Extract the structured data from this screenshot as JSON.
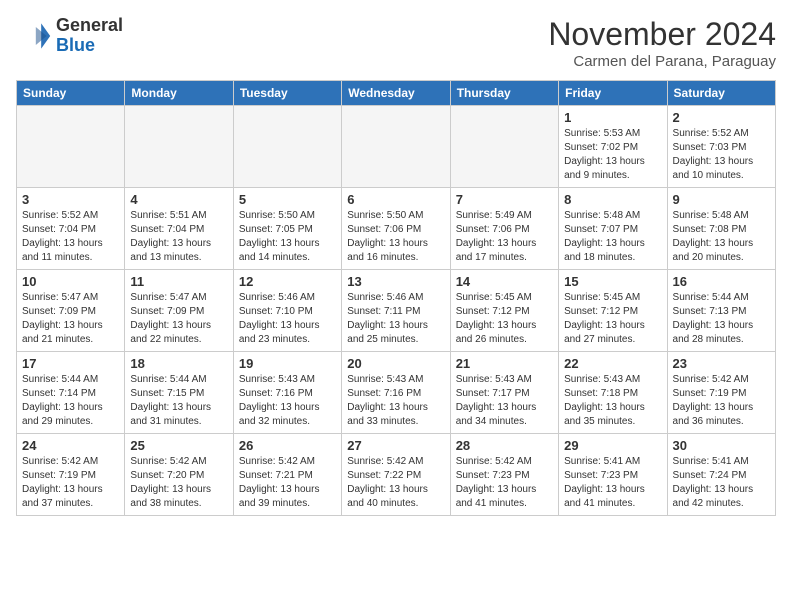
{
  "header": {
    "logo_line1": "General",
    "logo_line2": "Blue",
    "month": "November 2024",
    "location": "Carmen del Parana, Paraguay"
  },
  "weekdays": [
    "Sunday",
    "Monday",
    "Tuesday",
    "Wednesday",
    "Thursday",
    "Friday",
    "Saturday"
  ],
  "weeks": [
    [
      {
        "day": null
      },
      {
        "day": null
      },
      {
        "day": null
      },
      {
        "day": null
      },
      {
        "day": null
      },
      {
        "day": "1",
        "sunrise": "5:53 AM",
        "sunset": "7:02 PM",
        "daylight": "13 hours and 9 minutes."
      },
      {
        "day": "2",
        "sunrise": "5:52 AM",
        "sunset": "7:03 PM",
        "daylight": "13 hours and 10 minutes."
      }
    ],
    [
      {
        "day": "3",
        "sunrise": "5:52 AM",
        "sunset": "7:04 PM",
        "daylight": "13 hours and 11 minutes."
      },
      {
        "day": "4",
        "sunrise": "5:51 AM",
        "sunset": "7:04 PM",
        "daylight": "13 hours and 13 minutes."
      },
      {
        "day": "5",
        "sunrise": "5:50 AM",
        "sunset": "7:05 PM",
        "daylight": "13 hours and 14 minutes."
      },
      {
        "day": "6",
        "sunrise": "5:50 AM",
        "sunset": "7:06 PM",
        "daylight": "13 hours and 16 minutes."
      },
      {
        "day": "7",
        "sunrise": "5:49 AM",
        "sunset": "7:06 PM",
        "daylight": "13 hours and 17 minutes."
      },
      {
        "day": "8",
        "sunrise": "5:48 AM",
        "sunset": "7:07 PM",
        "daylight": "13 hours and 18 minutes."
      },
      {
        "day": "9",
        "sunrise": "5:48 AM",
        "sunset": "7:08 PM",
        "daylight": "13 hours and 20 minutes."
      }
    ],
    [
      {
        "day": "10",
        "sunrise": "5:47 AM",
        "sunset": "7:09 PM",
        "daylight": "13 hours and 21 minutes."
      },
      {
        "day": "11",
        "sunrise": "5:47 AM",
        "sunset": "7:09 PM",
        "daylight": "13 hours and 22 minutes."
      },
      {
        "day": "12",
        "sunrise": "5:46 AM",
        "sunset": "7:10 PM",
        "daylight": "13 hours and 23 minutes."
      },
      {
        "day": "13",
        "sunrise": "5:46 AM",
        "sunset": "7:11 PM",
        "daylight": "13 hours and 25 minutes."
      },
      {
        "day": "14",
        "sunrise": "5:45 AM",
        "sunset": "7:12 PM",
        "daylight": "13 hours and 26 minutes."
      },
      {
        "day": "15",
        "sunrise": "5:45 AM",
        "sunset": "7:12 PM",
        "daylight": "13 hours and 27 minutes."
      },
      {
        "day": "16",
        "sunrise": "5:44 AM",
        "sunset": "7:13 PM",
        "daylight": "13 hours and 28 minutes."
      }
    ],
    [
      {
        "day": "17",
        "sunrise": "5:44 AM",
        "sunset": "7:14 PM",
        "daylight": "13 hours and 29 minutes."
      },
      {
        "day": "18",
        "sunrise": "5:44 AM",
        "sunset": "7:15 PM",
        "daylight": "13 hours and 31 minutes."
      },
      {
        "day": "19",
        "sunrise": "5:43 AM",
        "sunset": "7:16 PM",
        "daylight": "13 hours and 32 minutes."
      },
      {
        "day": "20",
        "sunrise": "5:43 AM",
        "sunset": "7:16 PM",
        "daylight": "13 hours and 33 minutes."
      },
      {
        "day": "21",
        "sunrise": "5:43 AM",
        "sunset": "7:17 PM",
        "daylight": "13 hours and 34 minutes."
      },
      {
        "day": "22",
        "sunrise": "5:43 AM",
        "sunset": "7:18 PM",
        "daylight": "13 hours and 35 minutes."
      },
      {
        "day": "23",
        "sunrise": "5:42 AM",
        "sunset": "7:19 PM",
        "daylight": "13 hours and 36 minutes."
      }
    ],
    [
      {
        "day": "24",
        "sunrise": "5:42 AM",
        "sunset": "7:19 PM",
        "daylight": "13 hours and 37 minutes."
      },
      {
        "day": "25",
        "sunrise": "5:42 AM",
        "sunset": "7:20 PM",
        "daylight": "13 hours and 38 minutes."
      },
      {
        "day": "26",
        "sunrise": "5:42 AM",
        "sunset": "7:21 PM",
        "daylight": "13 hours and 39 minutes."
      },
      {
        "day": "27",
        "sunrise": "5:42 AM",
        "sunset": "7:22 PM",
        "daylight": "13 hours and 40 minutes."
      },
      {
        "day": "28",
        "sunrise": "5:42 AM",
        "sunset": "7:23 PM",
        "daylight": "13 hours and 41 minutes."
      },
      {
        "day": "29",
        "sunrise": "5:41 AM",
        "sunset": "7:23 PM",
        "daylight": "13 hours and 41 minutes."
      },
      {
        "day": "30",
        "sunrise": "5:41 AM",
        "sunset": "7:24 PM",
        "daylight": "13 hours and 42 minutes."
      }
    ]
  ]
}
